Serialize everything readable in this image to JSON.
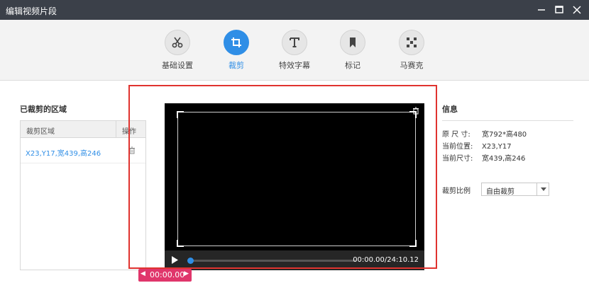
{
  "window": {
    "title": "编辑视频片段"
  },
  "toolbar": {
    "tools": [
      {
        "label": "基础设置",
        "icon": "scissors-icon"
      },
      {
        "label": "裁剪",
        "icon": "crop-icon",
        "active": true
      },
      {
        "label": "特效字幕",
        "icon": "text-t-icon"
      },
      {
        "label": "标记",
        "icon": "bookmark-icon"
      },
      {
        "label": "马赛克",
        "icon": "mosaic-icon"
      }
    ]
  },
  "cropped_regions": {
    "title": "已裁剪的区域",
    "headers": [
      "裁剪区域",
      "操作"
    ],
    "rows": [
      {
        "region": "X23,Y17,宽439,高246"
      }
    ]
  },
  "player": {
    "time": "00:00.00/24:10.12",
    "progress": 0.0
  },
  "timeline_tag": {
    "time": "00:00.00"
  },
  "info": {
    "title": "信息",
    "original_size_label": "原 尺 寸:",
    "original_size_value": "宽792*高480",
    "position_label": "当前位置:",
    "position_value": "X23,Y17",
    "size_label": "当前尺寸:",
    "size_value": "宽439,高246",
    "ratio_label": "裁剪比例",
    "ratio_value": "自由裁剪"
  },
  "colors": {
    "accent": "#2f8ee6",
    "titlebar": "#3b4049",
    "highlight": "#e0332f",
    "tag": "#e0366b"
  }
}
